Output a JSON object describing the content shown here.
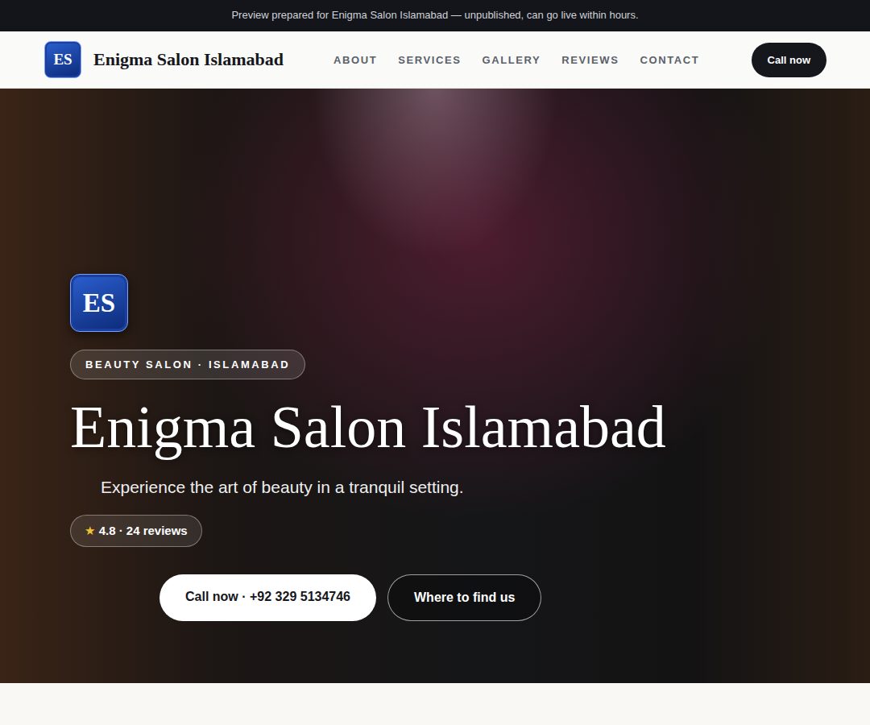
{
  "banner": "Preview prepared for Enigma Salon Islamabad — unpublished, can go live within hours.",
  "brand": {
    "initials": "ES",
    "name": "Enigma Salon Islamabad"
  },
  "nav": {
    "links": [
      "ABOUT",
      "SERVICES",
      "GALLERY",
      "REVIEWS",
      "CONTACT"
    ],
    "cta": "Call now"
  },
  "hero": {
    "initials": "ES",
    "eyebrow": "BEAUTY SALON · ISLAMABAD",
    "title": "Enigma Salon Islamabad",
    "tagline": "Experience the art of beauty in a tranquil setting.",
    "rating": {
      "star": "★",
      "text": "4.8 · 24 reviews"
    },
    "buttons": [
      {
        "label": "Call now · +92 329 5134746",
        "kind": "primary"
      },
      {
        "label": "Where to find us",
        "kind": "secondary"
      }
    ]
  }
}
